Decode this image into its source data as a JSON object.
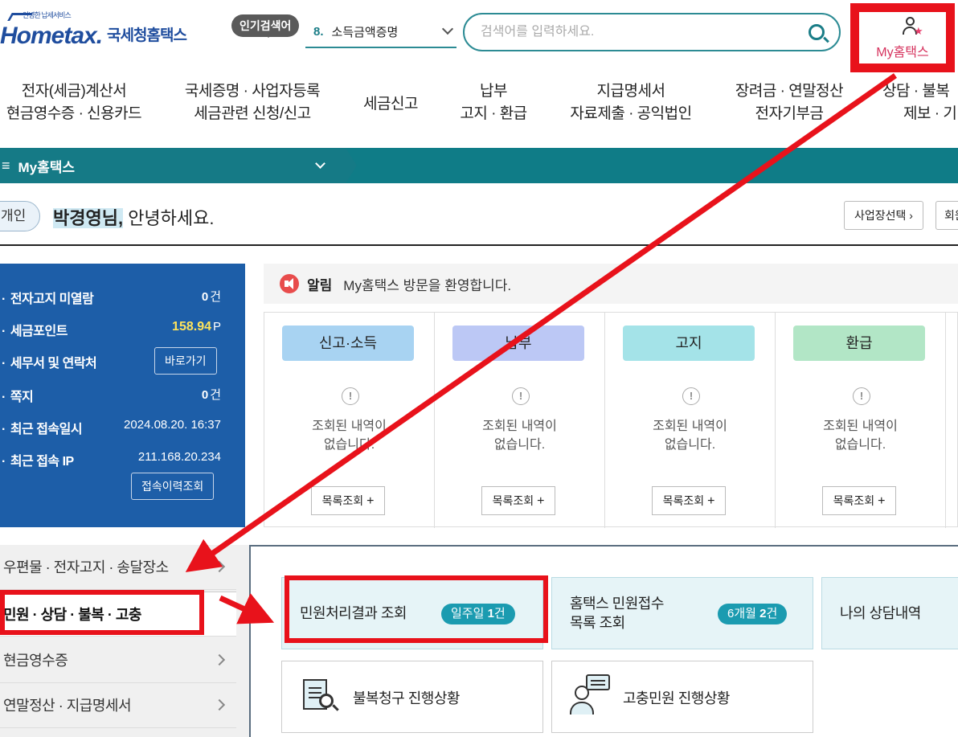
{
  "header": {
    "logo_small": "안녕한 납세서비스",
    "logo_main": "Hometax.",
    "logo_kr": "국세청홈택스",
    "popular_tag": "인기검색어",
    "popular_rank": "8.",
    "popular_term": "소득금액증명",
    "search_placeholder": "검색어를 입력하세요.",
    "my_hometax_label": "My홈택스"
  },
  "nav": [
    {
      "line1": "전자(세금)계산서",
      "line2": "현금영수증 · 신용카드"
    },
    {
      "line1": "국세증명 · 사업자등록",
      "line2": "세금관련 신청/신고"
    },
    {
      "line1": "세금신고",
      "line2": ""
    },
    {
      "line1": "납부",
      "line2": "고지 · 환급"
    },
    {
      "line1": "지급명세서",
      "line2": "자료제출 · 공익법인"
    },
    {
      "line1": "장려금 · 연말정산",
      "line2": "전자기부금"
    },
    {
      "line1": "상담 · 불복",
      "line2": "제보 · 기"
    }
  ],
  "mybar": {
    "menu_icon": "≡",
    "title": "My홈택스"
  },
  "greeting": {
    "badge": "개인",
    "name": "박경영님,",
    "text": " 안녕하세요.",
    "btn_business": "사업장선택 ›",
    "btn_member": "회원"
  },
  "info": {
    "unread_label": "전자고지 미열람",
    "unread_value": "0",
    "unread_unit": "건",
    "points_label": "세금포인트",
    "points_value": "158.94",
    "points_unit": "P",
    "office_label": "세무서 및 연락처",
    "office_btn": "바로가기",
    "memo_label": "쪽지",
    "memo_value": "0",
    "memo_unit": "건",
    "last_login_label": "최근 접속일시",
    "last_login_value": "2024.08.20.  16:37",
    "last_ip_label": "최근 접속 IP",
    "last_ip_value": "211.168.20.234",
    "history_btn": "접속이력조회"
  },
  "notice": {
    "title": "알림",
    "message": "My홈택스 방문을 환영합니다."
  },
  "cards": [
    {
      "title": "신고·소득",
      "color": "#a8d3f2",
      "msg1": "조회된 내역이",
      "msg2": "없습니다.",
      "btn": "목록조회"
    },
    {
      "title": "납부",
      "color": "#bcc8f5",
      "msg1": "조회된 내역이",
      "msg2": "없습니다.",
      "btn": "목록조회"
    },
    {
      "title": "고지",
      "color": "#a4e3e8",
      "msg1": "조회된 내역이",
      "msg2": "없습니다.",
      "btn": "목록조회"
    },
    {
      "title": "환급",
      "color": "#b2e6c6",
      "msg1": "조회된 내역이",
      "msg2": "없습니다.",
      "btn": "목록조회"
    }
  ],
  "side_menu": [
    {
      "label": "우편물 · 전자고지 · 송달장소"
    },
    {
      "label": "민원 · 상담 · 불복 · 고충"
    },
    {
      "label": "현금영수증"
    },
    {
      "label": "연말정산 · 지급명세서"
    }
  ],
  "services": {
    "result_label": "민원처리결과 조회",
    "result_badge_pre": "일주일 ",
    "result_badge_num": "1",
    "result_badge_unit": "건",
    "receipt_line1": "홈택스 민원접수",
    "receipt_line2": "목록 조회",
    "receipt_badge_pre": "6개월 ",
    "receipt_badge_num": "2",
    "receipt_badge_unit": "건",
    "consult_label": "나의 상담내역",
    "appeal_label": "불복청구 진행상황",
    "grievance_label": "고충민원 진행상황"
  },
  "annotation_color": "#e8121b"
}
